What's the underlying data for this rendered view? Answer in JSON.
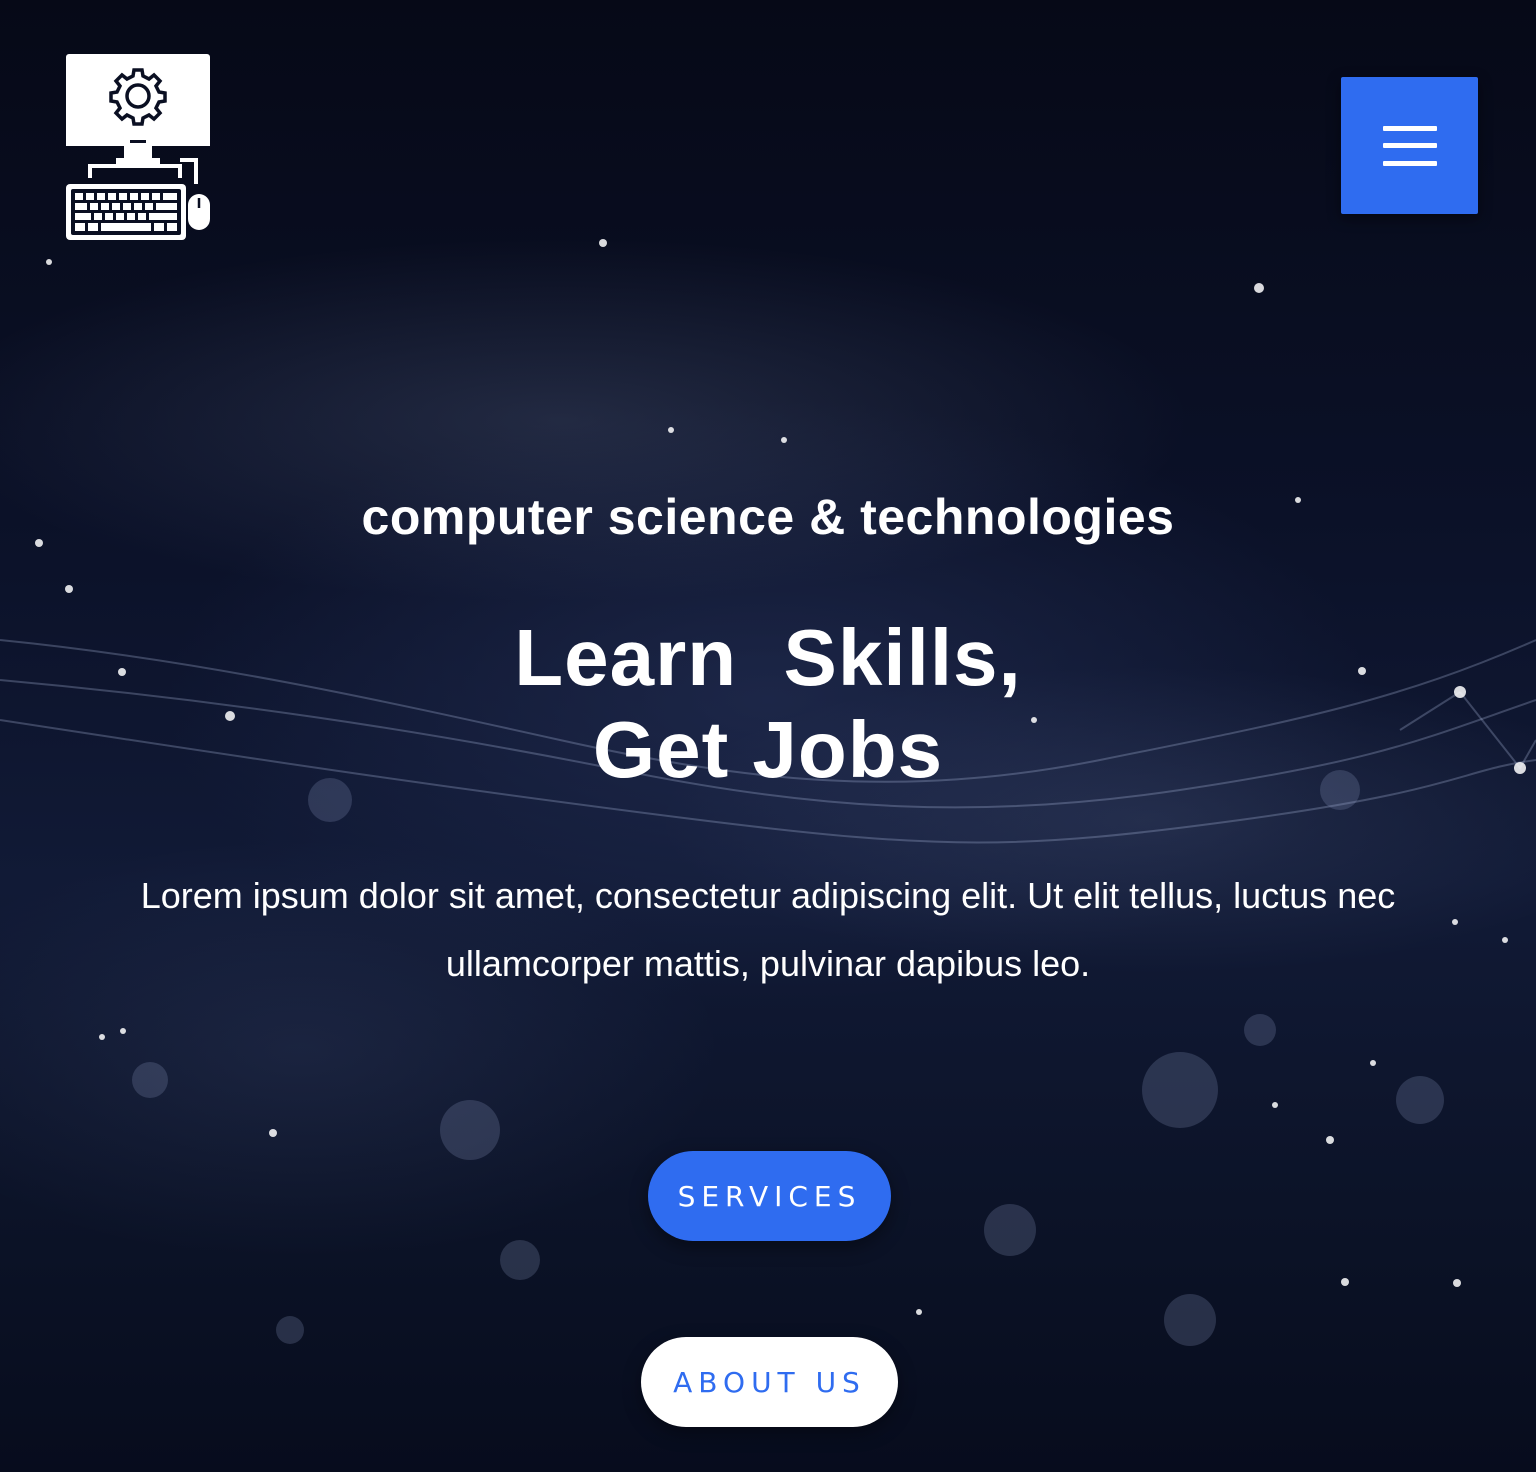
{
  "header": {
    "logo_icon": "computer-gear-icon",
    "menu_icon": "hamburger-menu-icon",
    "menu_button_color": "#2f6cf0"
  },
  "hero": {
    "tagline": "computer science & technologies",
    "headline_line1": "Learn  Skills,",
    "headline_line2": "Get Jobs",
    "description": "Lorem ipsum dolor sit amet, consectetur adipiscing elit. Ut elit tellus, luctus nec ullamcorper mattis, pulvinar dapibus leo.",
    "services_button_label": "SERVICES",
    "about_button_label": "ABOUT US",
    "accent_color": "#2f6cf0",
    "background_color": "#0b1128"
  }
}
